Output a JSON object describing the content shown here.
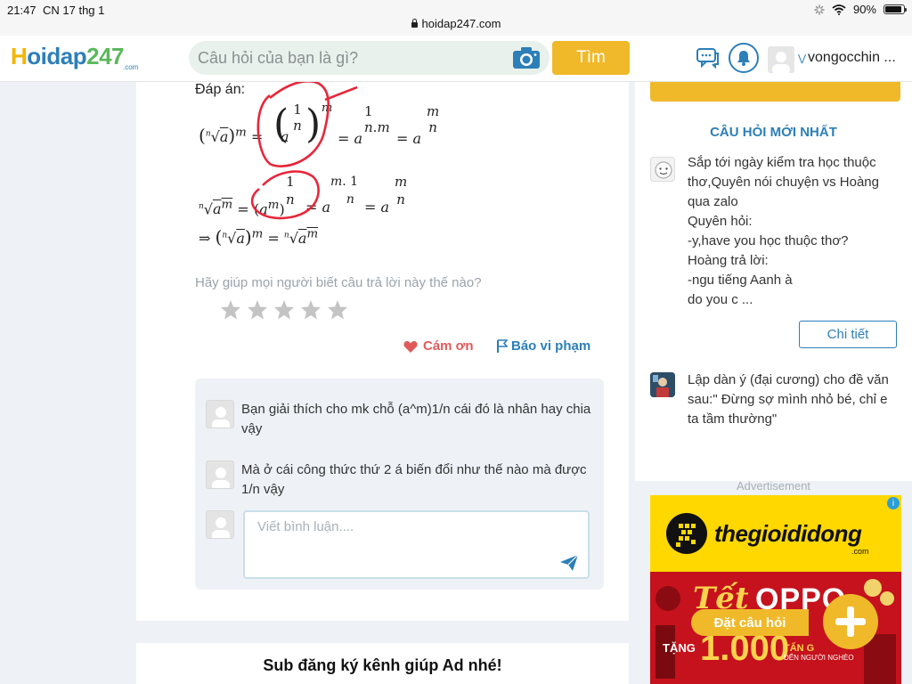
{
  "status": {
    "time": "21:47",
    "date": "CN 17 thg 1",
    "url": "hoidap247.com",
    "battery": "90%",
    "battery_level": 0.9
  },
  "header": {
    "logo_h": "H",
    "logo_oidap": "oidap",
    "logo_247": "247",
    "logo_com": ".com",
    "search_placeholder": "Câu hỏi của bạn là gì?",
    "search_button": "Tìm",
    "username": "vongocchin ..."
  },
  "answer": {
    "label": "Đáp án:",
    "prompt": "Hãy giúp mọi người biết câu trả lời này thế nào?",
    "rating": 0,
    "thanks": "Cám ơn",
    "report": "Báo vi phạm"
  },
  "comments": {
    "items": [
      {
        "text": "Bạn giải thích cho mk chỗ (a^m)1/n cái đó là nhân hay chia vậy"
      },
      {
        "text": "Mà ở cái công thức thứ 2 á biến đổi như thế nào mà được  1/n vậy"
      }
    ],
    "input_placeholder": "Viết bình luận...."
  },
  "next_card": {
    "title": "Sub đăng ký kênh giúp Ad nhé!"
  },
  "sidebar": {
    "heading": "CÂU HỎI MỚI NHẤT",
    "questions": [
      {
        "lines": [
          "Sắp tới ngày kiểm tra học thuộc",
          "thơ,Quyên nói chuyện vs Hoàng",
          "qua zalo",
          "Quyên hỏi:",
          "-y,have you học thuộc thơ?",
          "Hoàng trả lời:",
          "-ngu tiếng Aanh à",
          "do you c ..."
        ]
      },
      {
        "lines": [
          "Lập dàn ý (đại cương) cho đề văn",
          "sau:\" Đừng sợ mình nhỏ bé, chỉ e",
          "ta tầm thường\""
        ]
      }
    ],
    "detail_button": "Chi tiết",
    "advertisement": "Advertisement"
  },
  "ad": {
    "brand": "thegioididong",
    "brand_com": ".com",
    "tet": "Tết",
    "oppo": "OPPO",
    "tang": "TẶNG",
    "amount": "1.000",
    "tan": "TẤN G",
    "sub": "ĐẾN NGƯỜI NGHÈO"
  },
  "floating": {
    "ask_label": "Đặt câu hỏi"
  },
  "colors": {
    "primary": "#2d7fb8",
    "accent": "#f0b92a",
    "heart": "#e05a5a",
    "annotation": "#e8263a"
  }
}
